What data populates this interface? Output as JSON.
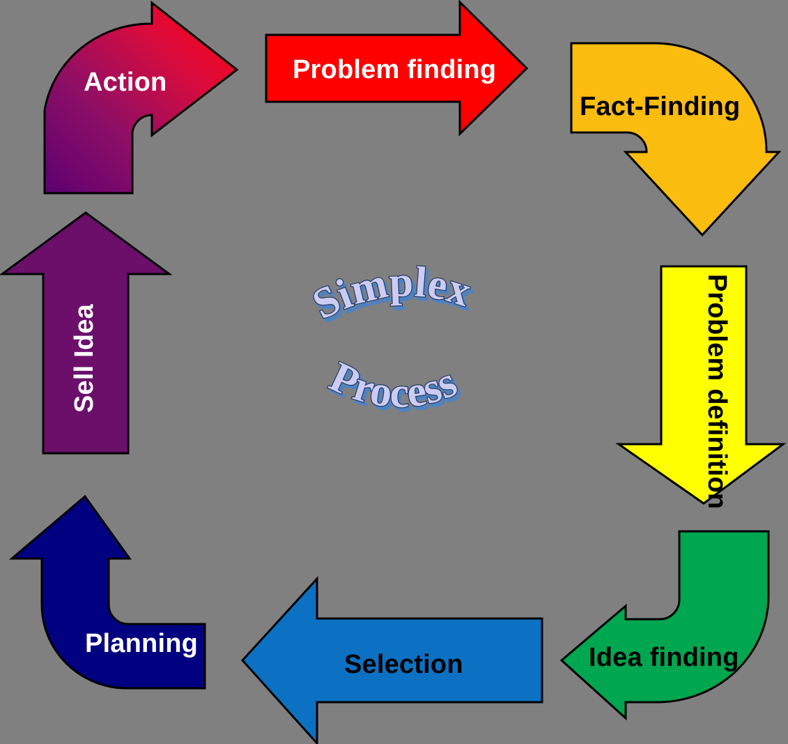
{
  "diagram": {
    "title_word_1": "Simplex",
    "title_word_2": "Process",
    "background_color": "#808080",
    "outline_color": "#000000"
  },
  "steps": [
    {
      "id": "problem-finding",
      "label": "Problem finding",
      "color": "#FF0000",
      "text_color": "#FFFFFF",
      "direction": "right",
      "shape": "straight-arrow",
      "position": "top-center"
    },
    {
      "id": "fact-finding",
      "label": "Fact-Finding",
      "color": "#FBBC10",
      "text_color": "#000000",
      "direction": "down",
      "shape": "curved-arrow",
      "position": "top-right"
    },
    {
      "id": "problem-definition",
      "label": "Problem definition",
      "color": "#FFFF00",
      "text_color": "#000000",
      "direction": "down",
      "shape": "straight-arrow",
      "position": "right"
    },
    {
      "id": "idea-finding",
      "label": "Idea finding",
      "color": "#00A650",
      "text_color": "#000000",
      "direction": "left",
      "shape": "curved-arrow",
      "position": "bottom-right"
    },
    {
      "id": "selection",
      "label": "Selection",
      "color": "#0C71C3",
      "text_color": "#000000",
      "direction": "left",
      "shape": "straight-arrow",
      "position": "bottom-center"
    },
    {
      "id": "planning",
      "label": "Planning",
      "color": "#000080",
      "text_color": "#FFFFFF",
      "direction": "up",
      "shape": "curved-arrow",
      "position": "bottom-left"
    },
    {
      "id": "sell-idea",
      "label": "Sell Idea",
      "color": "#6B0F6B",
      "text_color": "#FFFFFF",
      "direction": "up",
      "shape": "straight-arrow",
      "position": "left"
    },
    {
      "id": "action",
      "label": "Action",
      "color_start": "#6B0080",
      "color_end": "#FF0000",
      "text_color": "#FFFFFF",
      "direction": "right",
      "shape": "curved-arrow-gradient",
      "position": "top-left"
    }
  ],
  "chart_data": {
    "type": "diagram",
    "subtype": "cycle",
    "title": "Simplex Process",
    "node_count": 8,
    "nodes": [
      "Problem finding",
      "Fact-Finding",
      "Problem definition",
      "Idea finding",
      "Selection",
      "Planning",
      "Sell Idea",
      "Action"
    ],
    "flow": "clockwise"
  }
}
